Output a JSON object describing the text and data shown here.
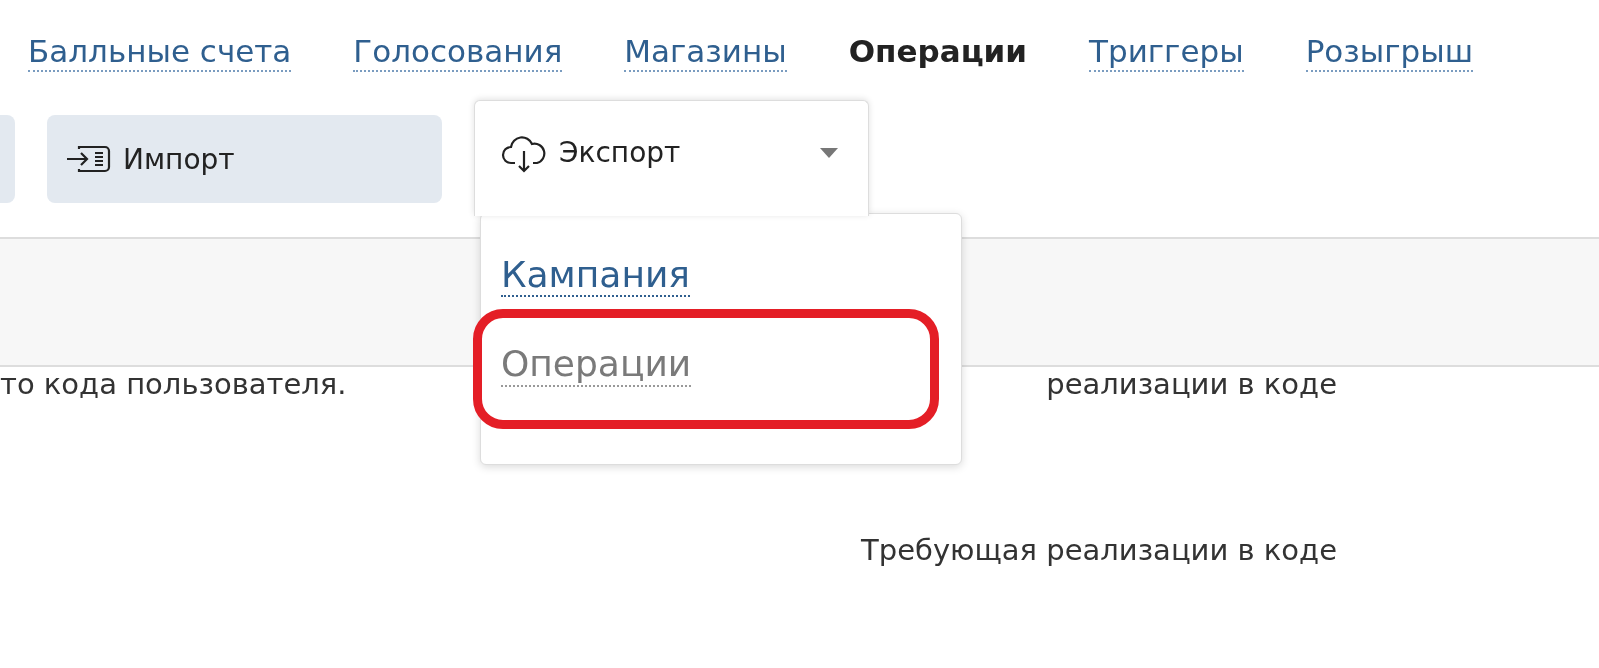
{
  "nav_tabs": [
    {
      "label": "Балльные счета",
      "selected": false
    },
    {
      "label": "Голосования",
      "selected": false
    },
    {
      "label": "Магазины",
      "selected": false
    },
    {
      "label": "Операции",
      "selected": true
    },
    {
      "label": "Триггеры",
      "selected": false
    },
    {
      "label": "Розыгрыш",
      "selected": false
    }
  ],
  "toolbar": {
    "buttons": [
      {
        "kind": "cut_off"
      },
      {
        "kind": "import",
        "label": "Импорт"
      },
      {
        "kind": "export",
        "label": "Экспорт",
        "expanded": true
      }
    ]
  },
  "export_menu": {
    "items": [
      {
        "label": "Кампания",
        "disabled": false,
        "highlighted": false
      },
      {
        "label": "Операции",
        "disabled": true,
        "highlighted": true
      }
    ]
  },
  "rows": [
    {
      "column_1": "то кода пользователя.",
      "column_2": "реализации в коде"
    },
    {
      "column_2": "Требующая реализации в коде"
    }
  ]
}
